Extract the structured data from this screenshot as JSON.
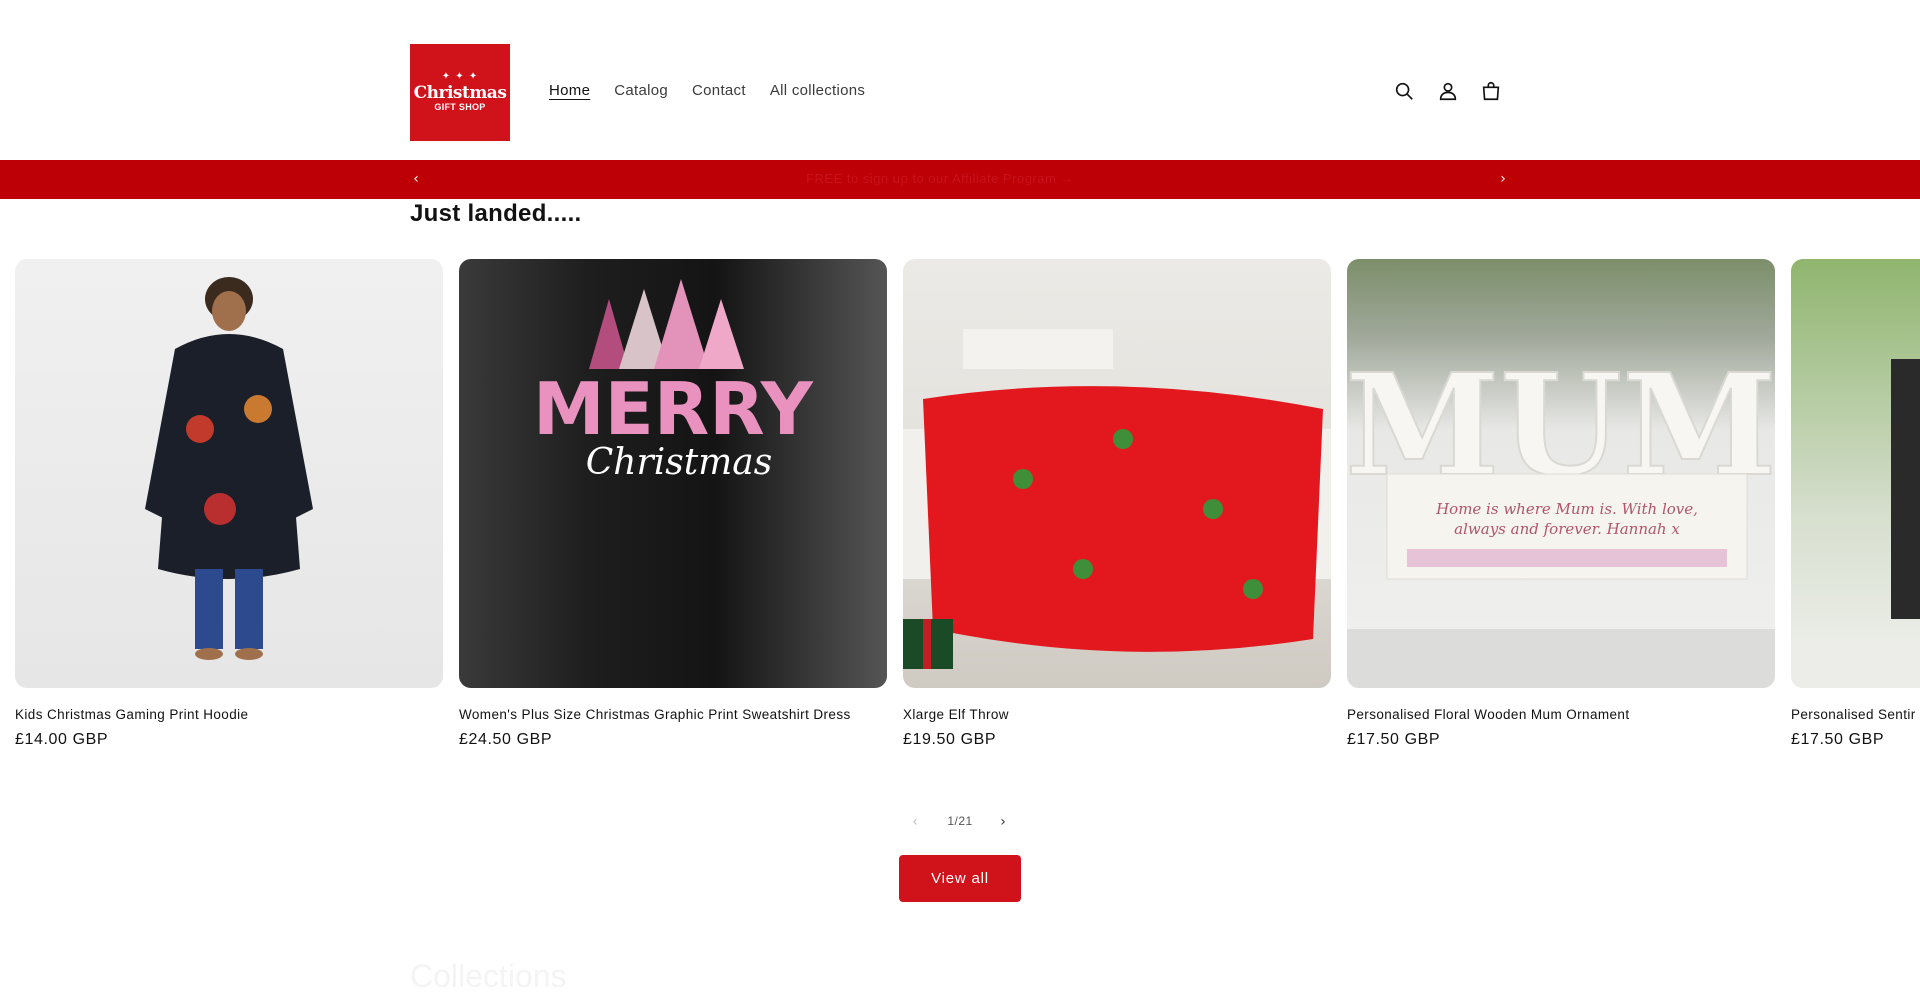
{
  "logo": {
    "line1": "Christmas",
    "line2": "GIFT SHOP"
  },
  "nav": {
    "items": [
      {
        "label": "Home",
        "active": true
      },
      {
        "label": "Catalog",
        "active": false
      },
      {
        "label": "Contact",
        "active": false
      },
      {
        "label": "All collections",
        "active": false
      }
    ]
  },
  "header_icons": [
    "search-icon",
    "account-icon",
    "cart-icon"
  ],
  "announcement": {
    "text": "FREE to sign up to our Affiliate Program →"
  },
  "section": {
    "title": "Just landed....."
  },
  "products": [
    {
      "title": "Kids Christmas Gaming Print Hoodie",
      "price": "£14.00 GBP"
    },
    {
      "title": "Women's Plus Size Christmas Graphic Print Sweatshirt Dress",
      "price": "£24.50 GBP",
      "image_text": {
        "line1": "MERRY",
        "line2": "Christmas"
      }
    },
    {
      "title": "Xlarge Elf Throw",
      "price": "£19.50 GBP"
    },
    {
      "title": "Personalised Floral Wooden Mum Ornament",
      "price": "£17.50 GBP",
      "image_text": {
        "line1": "MUM",
        "line2": "Home is where Mum is. With love,",
        "line3": "always and forever. Hannah x"
      }
    },
    {
      "title": "Personalised Sentir",
      "price": "£17.50 GBP"
    }
  ],
  "slider": {
    "counter": "1/21"
  },
  "view_all_label": "View all",
  "next_section_title": "Collections",
  "colors": {
    "brand_red": "#d0121b",
    "announcement_bg": "#bd0006"
  }
}
